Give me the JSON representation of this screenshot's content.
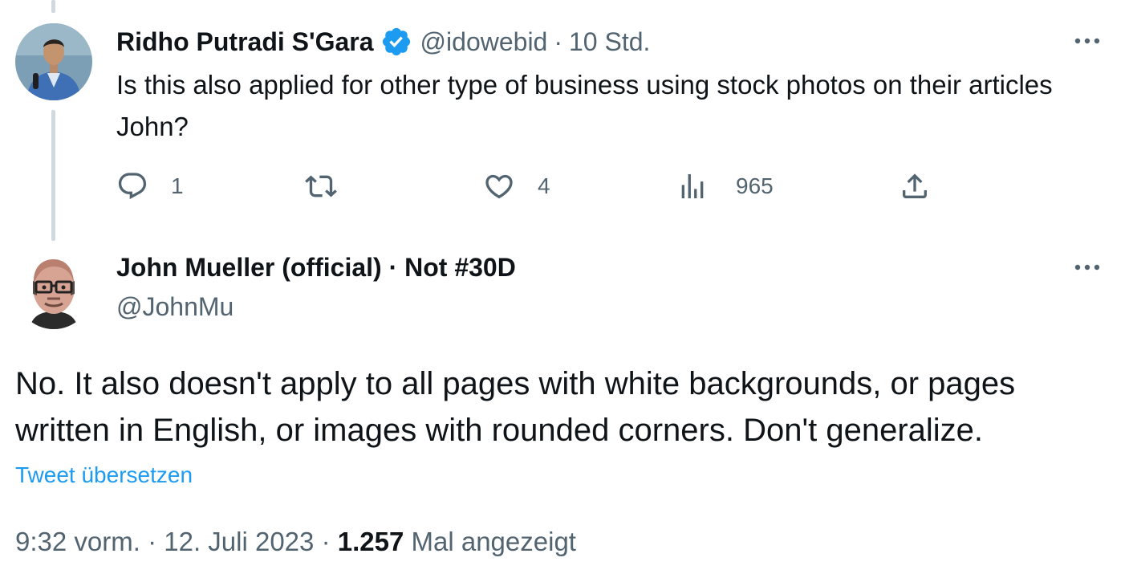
{
  "reply_tweet": {
    "author_name": "Ridho Putradi S'Gara",
    "verified": true,
    "handle": "@idowebid",
    "separator": "·",
    "time_ago": "10 Std.",
    "text": "Is this also applied for other type of business  using stock photos on their articles John?",
    "actions": {
      "reply_count": "1",
      "retweet_count": "",
      "like_count": "4",
      "view_count": "965"
    }
  },
  "main_tweet": {
    "author_name": "John Mueller (official) · Not #30D",
    "handle": "@JohnMu",
    "text": "No. It also doesn't apply to all pages with white backgrounds, or pages written in English, or images with rounded corners. Don't generalize.",
    "translate_label": "Tweet übersetzen",
    "time": "9:32 vorm.",
    "separator": "·",
    "date": "12. Juli 2023",
    "view_count": "1.257",
    "view_label": "Mal angezeigt"
  },
  "colors": {
    "text_primary": "#0f1419",
    "text_secondary": "#536471",
    "link": "#1d9bf0",
    "verified_badge": "#1d9bf0",
    "thread_line": "#cfd9de"
  },
  "icons": {
    "reply": "speech-bubble-icon",
    "retweet": "retweet-icon",
    "like": "heart-icon",
    "views": "bar-chart-icon",
    "share": "share-upload-icon",
    "more": "more-dots-icon",
    "verified": "verified-badge-icon"
  }
}
